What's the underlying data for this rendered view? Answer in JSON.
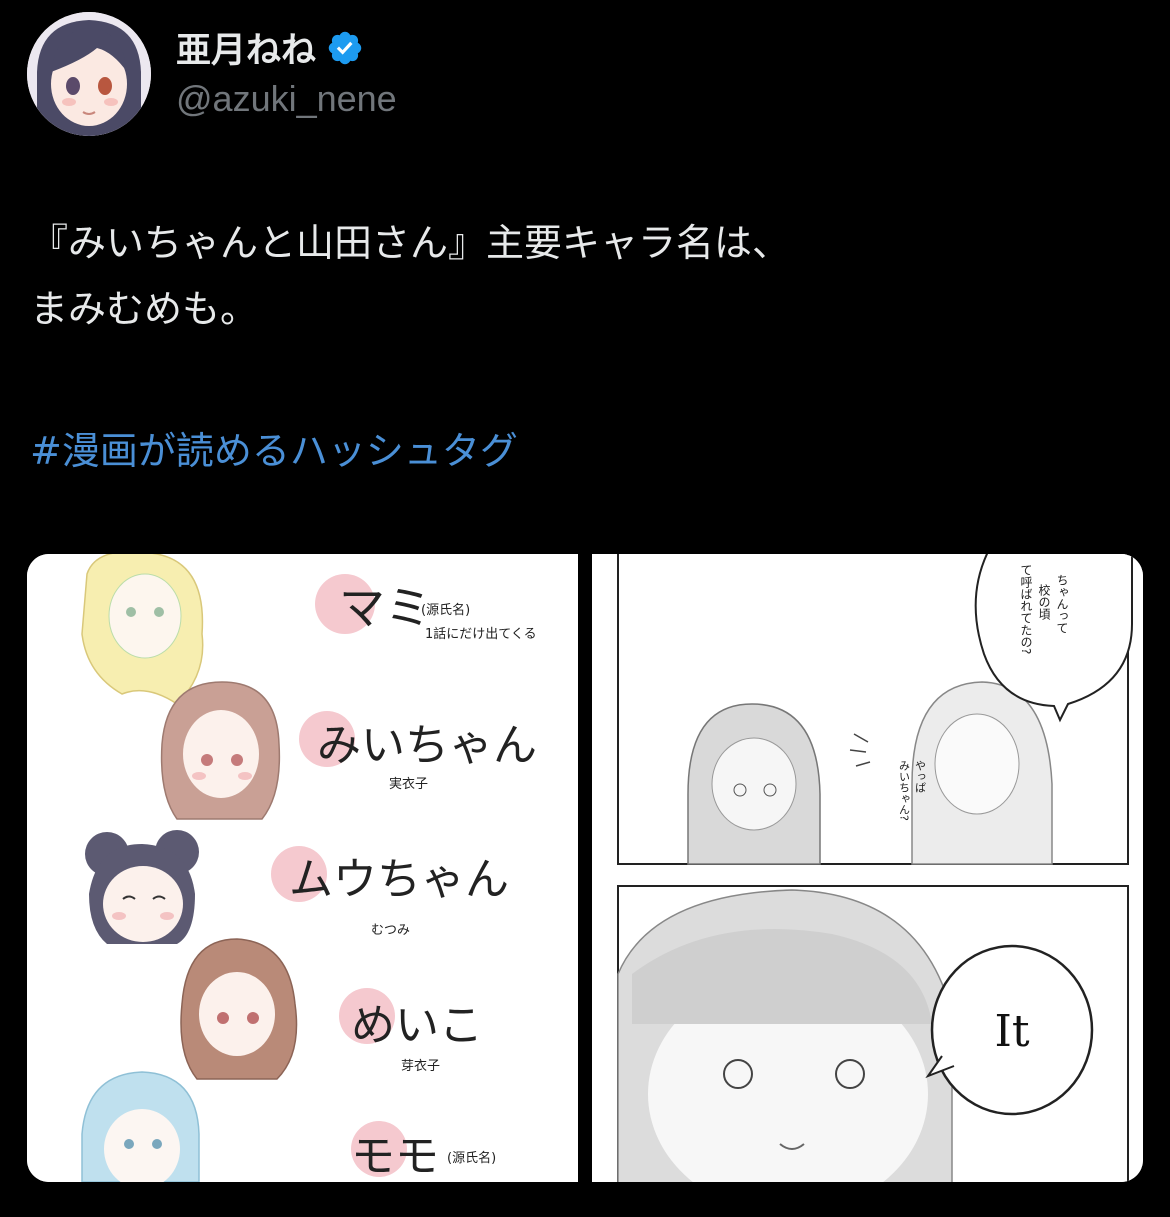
{
  "author": {
    "display_name": "亜月ねね",
    "handle": "@azuki_nene",
    "verified": true,
    "avatar_icon": "avatar-anime-girl"
  },
  "tweet": {
    "lines": [
      "『みいちゃんと山田さん』主要キャラ名は、",
      "まみむめも。"
    ],
    "hashtag": "#漫画が読めるハッシュタグ"
  },
  "media": {
    "left_image": {
      "characters": [
        {
          "name": "マミ",
          "note": "(源氏名)",
          "sub": "1話にだけ出てくる"
        },
        {
          "name": "みいちゃん",
          "sub": "実衣子"
        },
        {
          "name": "ムウちゃん",
          "sub": "むつみ"
        },
        {
          "name": "めいこ",
          "sub": "芽衣子"
        },
        {
          "name": "モモ",
          "note": "(源氏名)"
        }
      ]
    },
    "right_image": {
      "bubble_top": [
        "ちゃんって",
        "校の頃",
        "て呼ばれてたの?"
      ],
      "whisper": [
        "やっぱ",
        "みいちゃん?"
      ],
      "bubble_bottom": "It"
    }
  },
  "colors": {
    "background": "#000000",
    "text": "#e7e9ea",
    "handle": "#71767b",
    "hashtag": "#4a8fd6",
    "verified": "#1d9bf0",
    "name_blob": "#f5c9cf"
  }
}
